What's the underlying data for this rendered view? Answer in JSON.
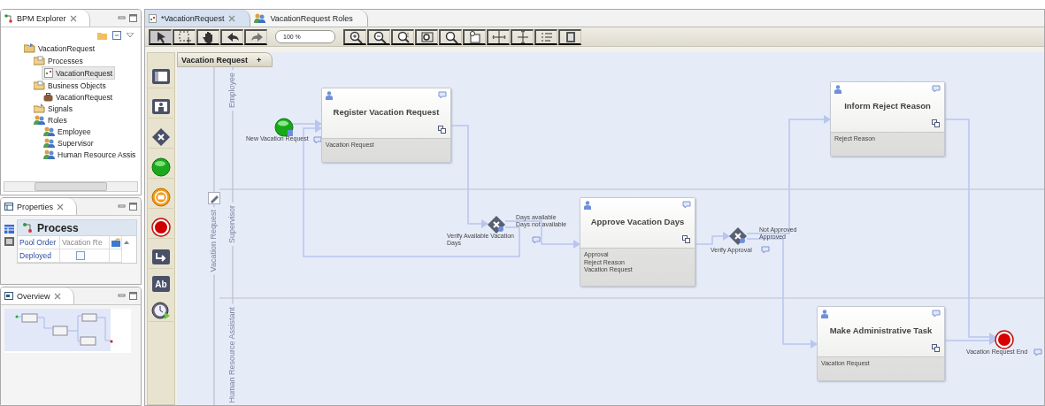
{
  "explorer": {
    "title": "BPM Explorer",
    "tree": [
      {
        "label": "VacationRequest",
        "kind": "project",
        "selected": false,
        "children": [
          {
            "label": "Processes",
            "kind": "folder",
            "selected": false,
            "children": [
              {
                "label": "VacationRequest",
                "kind": "process",
                "selected": true
              }
            ]
          },
          {
            "label": "Business Objects",
            "kind": "folder",
            "selected": false,
            "children": [
              {
                "label": "VacationRequest",
                "kind": "object",
                "selected": false
              }
            ]
          },
          {
            "label": "Signals",
            "kind": "signal",
            "selected": false
          },
          {
            "label": "Roles",
            "kind": "roles",
            "selected": false,
            "children": [
              {
                "label": "Employee",
                "kind": "role",
                "selected": false
              },
              {
                "label": "Supervisor",
                "kind": "role",
                "selected": false
              },
              {
                "label": "Human Resource Assis",
                "kind": "role",
                "selected": false
              }
            ]
          }
        ]
      }
    ]
  },
  "properties": {
    "title": "Properties",
    "header": "Process",
    "columns": [
      "Pool Order",
      "Vacation Re"
    ],
    "rows": [
      {
        "label": "Deployed",
        "checked": false
      }
    ]
  },
  "overview": {
    "title": "Overview"
  },
  "editor_tabs": [
    {
      "label": "*VacationRequest",
      "selected": true
    },
    {
      "label": "VacationRequest Roles",
      "selected": false
    }
  ],
  "toolbar": {
    "zoom": "100 %"
  },
  "palette": [
    {
      "kind": "pool"
    },
    {
      "kind": "lane"
    },
    {
      "kind": "gateway"
    },
    {
      "kind": "start"
    },
    {
      "kind": "message"
    },
    {
      "kind": "end"
    },
    {
      "kind": "subprocess"
    },
    {
      "kind": "text",
      "label": "Ab"
    },
    {
      "kind": "timer"
    }
  ],
  "diagram": {
    "pool_tab": "Vacation Request",
    "pool_tab_add": "+",
    "pool_label": "Vacation Request",
    "lanes": [
      {
        "label": "Employee"
      },
      {
        "label": "Supervisor"
      },
      {
        "label": "Human Resource Assistant"
      }
    ],
    "nodes": [
      {
        "kind": "start",
        "label": "New Vacation Request"
      },
      {
        "kind": "task",
        "title": "Register Vacation Request",
        "data": [
          "Vacation Request"
        ]
      },
      {
        "kind": "gateway",
        "label": "Verify Available Vacation Days",
        "branches": [
          "Days available",
          "Days not available"
        ]
      },
      {
        "kind": "task",
        "title": "Approve Vacation Days",
        "data": [
          "Approval",
          "Reject Reason",
          "Vacation Request"
        ]
      },
      {
        "kind": "gateway",
        "label": "Verify Approval",
        "branches": [
          "Not Approved",
          "Approved"
        ]
      },
      {
        "kind": "task",
        "title": "Inform Reject Reason",
        "data": [
          "Reject Reason"
        ]
      },
      {
        "kind": "task",
        "title": "Make Administrative Task",
        "data": [
          "Vacation Request"
        ]
      },
      {
        "kind": "end",
        "label": "Vacation Request End"
      }
    ]
  }
}
